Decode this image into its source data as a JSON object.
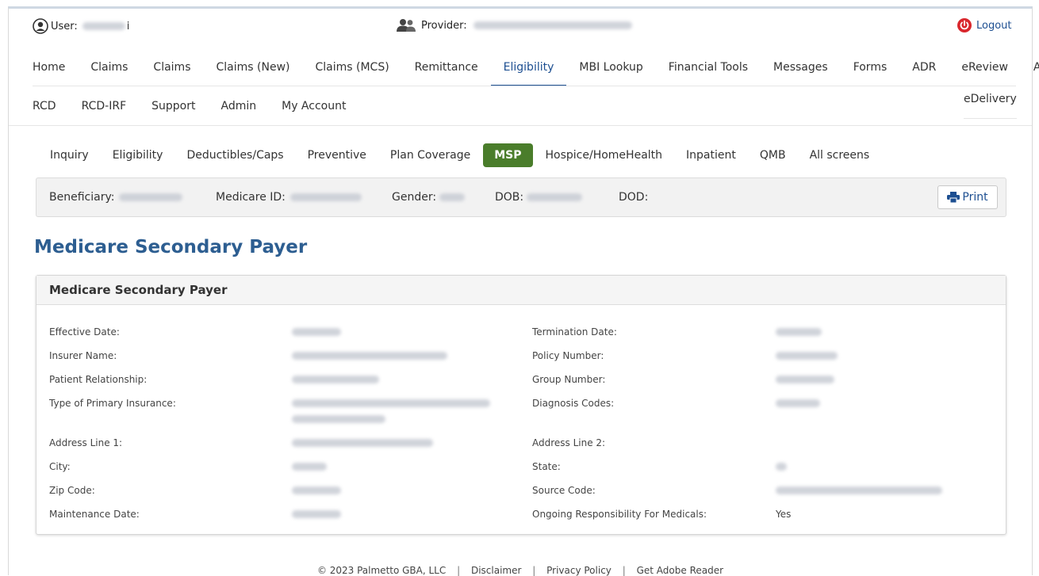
{
  "header": {
    "user_label": "User:",
    "user_suffix": "i",
    "provider_label": "Provider:",
    "logout_label": "Logout"
  },
  "nav_main": [
    "Home",
    "Claims",
    "Claims",
    "Claims (New)",
    "Claims (MCS)",
    "Remittance",
    "Eligibility",
    "MBI Lookup",
    "Financial Tools",
    "Messages",
    "Forms",
    "ADR",
    "eReview",
    "ACO"
  ],
  "nav_main_active": "Eligibility",
  "nav_secondary": [
    "RCD",
    "RCD-IRF",
    "Support",
    "Admin",
    "My Account"
  ],
  "nav_edelivery": "eDelivery",
  "subtabs": [
    "Inquiry",
    "Eligibility",
    "Deductibles/Caps",
    "Preventive",
    "Plan Coverage",
    "MSP",
    "Hospice/HomeHealth",
    "Inpatient",
    "QMB",
    "All screens"
  ],
  "subtabs_active": "MSP",
  "beneficiary_bar": {
    "beneficiary_label": "Beneficiary:",
    "medicare_id_label": "Medicare ID:",
    "gender_label": "Gender:",
    "dob_label": "DOB:",
    "dod_label": "DOD:",
    "print_label": "Print"
  },
  "page_title": "Medicare Secondary Payer",
  "panel": {
    "title": "Medicare Secondary Payer",
    "rows": [
      {
        "left": "Effective Date:",
        "right": "Termination Date:"
      },
      {
        "left": "Insurer Name:",
        "right": "Policy Number:"
      },
      {
        "left": "Patient Relationship:",
        "right": "Group Number:"
      },
      {
        "left": "Type of Primary Insurance:",
        "right": "Diagnosis Codes:"
      },
      {
        "left": "Address Line 1:",
        "right": "Address Line 2:"
      },
      {
        "left": "City:",
        "right": "State:"
      },
      {
        "left": "Zip Code:",
        "right": "Source Code:"
      },
      {
        "left": "Maintenance Date:",
        "right": "Ongoing Responsibility For Medicals:",
        "right_value": "Yes"
      }
    ]
  },
  "footer": {
    "copyright": "© 2023 Palmetto GBA, LLC",
    "sep": "|",
    "links": [
      "Disclaimer",
      "Privacy Policy",
      "Get Adobe Reader"
    ]
  },
  "colors": {
    "accent": "#1d4f91",
    "title": "#2d5e91",
    "active_tab": "#4a7d2b",
    "logout_icon": "#d9262c"
  }
}
